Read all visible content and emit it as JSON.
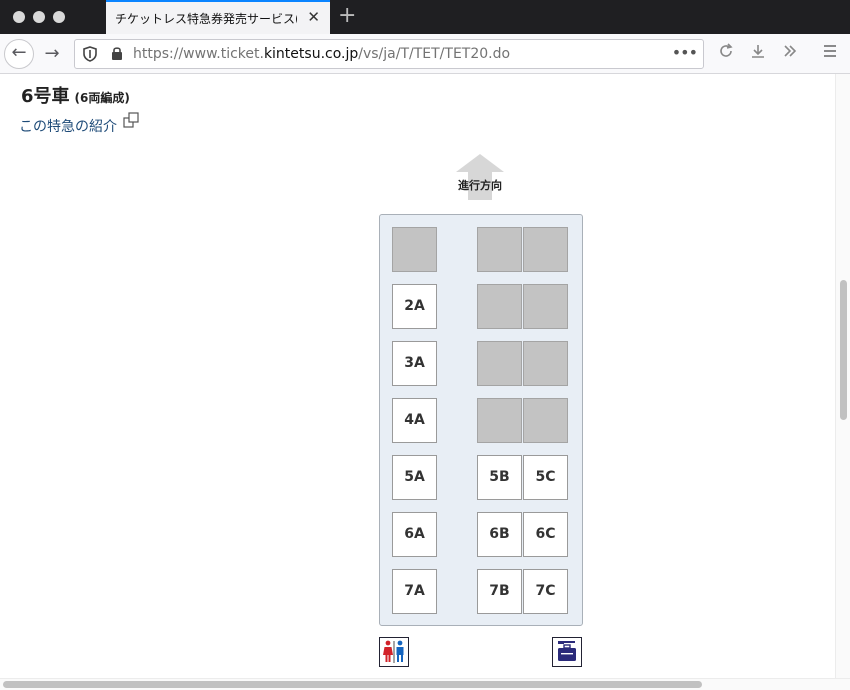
{
  "browser": {
    "tab_title": "チケットレス特急券発売サービス(会員登録",
    "url_prefix": "https://www.ticket.",
    "url_host": "kintetsu.co.jp",
    "url_path": "/vs/ja/T/TET/TET20.do",
    "icons": [
      "back-icon",
      "forward-icon",
      "shield-icon",
      "lock-icon",
      "more-icon",
      "reload-icon",
      "download-icon",
      "overflow-icon",
      "menu-icon",
      "close-icon",
      "new-tab-icon"
    ]
  },
  "page": {
    "car_number": "6号車",
    "car_formation": "(6両編成)",
    "intro_link": "この特急の紹介",
    "direction_label": "進行方向"
  },
  "seats": {
    "row2": {
      "a": "2A"
    },
    "row3": {
      "a": "3A"
    },
    "row4": {
      "a": "4A"
    },
    "row5": {
      "a": "5A",
      "b": "5B",
      "c": "5C"
    },
    "row6": {
      "a": "6A",
      "b": "6B",
      "c": "6C"
    },
    "row7": {
      "a": "7A",
      "b": "7B",
      "c": "7C"
    }
  },
  "colors": {
    "taken_seat": "#c3c3c3",
    "car_floor": "#e8eef5",
    "link": "#1e4b78",
    "tab_accent": "#0a84ff",
    "restroom_female": "#d2232a",
    "restroom_male": "#1565c0",
    "locker_icon": "#2a2a7a"
  }
}
